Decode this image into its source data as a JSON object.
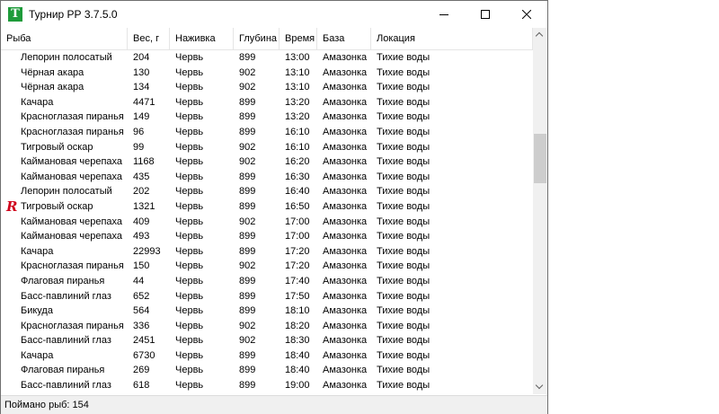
{
  "window": {
    "title": "Турнир РР 3.7.5.0",
    "icon_letter": "T"
  },
  "columns": [
    "Рыба",
    "Вес, г",
    "Наживка",
    "Глубина",
    "Время",
    "База",
    "Локация"
  ],
  "rows": [
    {
      "fish": "Лепорин полосатый",
      "weight": "204",
      "bait": "Червь",
      "depth": "899",
      "time": "13:00",
      "base": "Амазонка",
      "location": "Тихие воды",
      "flag": ""
    },
    {
      "fish": "Чёрная акара",
      "weight": "130",
      "bait": "Червь",
      "depth": "902",
      "time": "13:10",
      "base": "Амазонка",
      "location": "Тихие воды",
      "flag": ""
    },
    {
      "fish": "Чёрная акара",
      "weight": "134",
      "bait": "Червь",
      "depth": "902",
      "time": "13:10",
      "base": "Амазонка",
      "location": "Тихие воды",
      "flag": ""
    },
    {
      "fish": "Качара",
      "weight": "4471",
      "bait": "Червь",
      "depth": "899",
      "time": "13:20",
      "base": "Амазонка",
      "location": "Тихие воды",
      "flag": ""
    },
    {
      "fish": "Красноглазая пиранья",
      "weight": "149",
      "bait": "Червь",
      "depth": "899",
      "time": "13:20",
      "base": "Амазонка",
      "location": "Тихие воды",
      "flag": ""
    },
    {
      "fish": "Красноглазая пиранья",
      "weight": "96",
      "bait": "Червь",
      "depth": "899",
      "time": "16:10",
      "base": "Амазонка",
      "location": "Тихие воды",
      "flag": ""
    },
    {
      "fish": "Тигровый оскар",
      "weight": "99",
      "bait": "Червь",
      "depth": "902",
      "time": "16:10",
      "base": "Амазонка",
      "location": "Тихие воды",
      "flag": ""
    },
    {
      "fish": "Каймановая черепаха",
      "weight": "1168",
      "bait": "Червь",
      "depth": "902",
      "time": "16:20",
      "base": "Амазонка",
      "location": "Тихие воды",
      "flag": ""
    },
    {
      "fish": "Каймановая черепаха",
      "weight": "435",
      "bait": "Червь",
      "depth": "899",
      "time": "16:30",
      "base": "Амазонка",
      "location": "Тихие воды",
      "flag": ""
    },
    {
      "fish": "Лепорин полосатый",
      "weight": "202",
      "bait": "Червь",
      "depth": "899",
      "time": "16:40",
      "base": "Амазонка",
      "location": "Тихие воды",
      "flag": ""
    },
    {
      "fish": "Тигровый оскар",
      "weight": "1321",
      "bait": "Червь",
      "depth": "899",
      "time": "16:50",
      "base": "Амазонка",
      "location": "Тихие воды",
      "flag": "R"
    },
    {
      "fish": "Каймановая черепаха",
      "weight": "409",
      "bait": "Червь",
      "depth": "902",
      "time": "17:00",
      "base": "Амазонка",
      "location": "Тихие воды",
      "flag": ""
    },
    {
      "fish": "Каймановая черепаха",
      "weight": "493",
      "bait": "Червь",
      "depth": "899",
      "time": "17:00",
      "base": "Амазонка",
      "location": "Тихие воды",
      "flag": ""
    },
    {
      "fish": "Качара",
      "weight": "22993",
      "bait": "Червь",
      "depth": "899",
      "time": "17:20",
      "base": "Амазонка",
      "location": "Тихие воды",
      "flag": ""
    },
    {
      "fish": "Красноглазая пиранья",
      "weight": "150",
      "bait": "Червь",
      "depth": "902",
      "time": "17:20",
      "base": "Амазонка",
      "location": "Тихие воды",
      "flag": ""
    },
    {
      "fish": "Флаговая пиранья",
      "weight": "44",
      "bait": "Червь",
      "depth": "899",
      "time": "17:40",
      "base": "Амазонка",
      "location": "Тихие воды",
      "flag": ""
    },
    {
      "fish": "Басс-павлиний глаз",
      "weight": "652",
      "bait": "Червь",
      "depth": "899",
      "time": "17:50",
      "base": "Амазонка",
      "location": "Тихие воды",
      "flag": ""
    },
    {
      "fish": "Бикуда",
      "weight": "564",
      "bait": "Червь",
      "depth": "899",
      "time": "18:10",
      "base": "Амазонка",
      "location": "Тихие воды",
      "flag": ""
    },
    {
      "fish": "Красноглазая пиранья",
      "weight": "336",
      "bait": "Червь",
      "depth": "902",
      "time": "18:20",
      "base": "Амазонка",
      "location": "Тихие воды",
      "flag": ""
    },
    {
      "fish": "Басс-павлиний глаз",
      "weight": "2451",
      "bait": "Червь",
      "depth": "902",
      "time": "18:30",
      "base": "Амазонка",
      "location": "Тихие воды",
      "flag": ""
    },
    {
      "fish": "Качара",
      "weight": "6730",
      "bait": "Червь",
      "depth": "899",
      "time": "18:40",
      "base": "Амазонка",
      "location": "Тихие воды",
      "flag": ""
    },
    {
      "fish": "Флаговая пиранья",
      "weight": "269",
      "bait": "Червь",
      "depth": "899",
      "time": "18:40",
      "base": "Амазонка",
      "location": "Тихие воды",
      "flag": ""
    },
    {
      "fish": "Басс-павлиний глаз",
      "weight": "618",
      "bait": "Червь",
      "depth": "899",
      "time": "19:00",
      "base": "Амазонка",
      "location": "Тихие воды",
      "flag": ""
    }
  ],
  "status": {
    "caught_text": "Поймано рыб: 154"
  },
  "colors": {
    "app_icon": "#1e9b3a",
    "flag": "#d0021b",
    "statusbar": "#f0f0f0"
  }
}
